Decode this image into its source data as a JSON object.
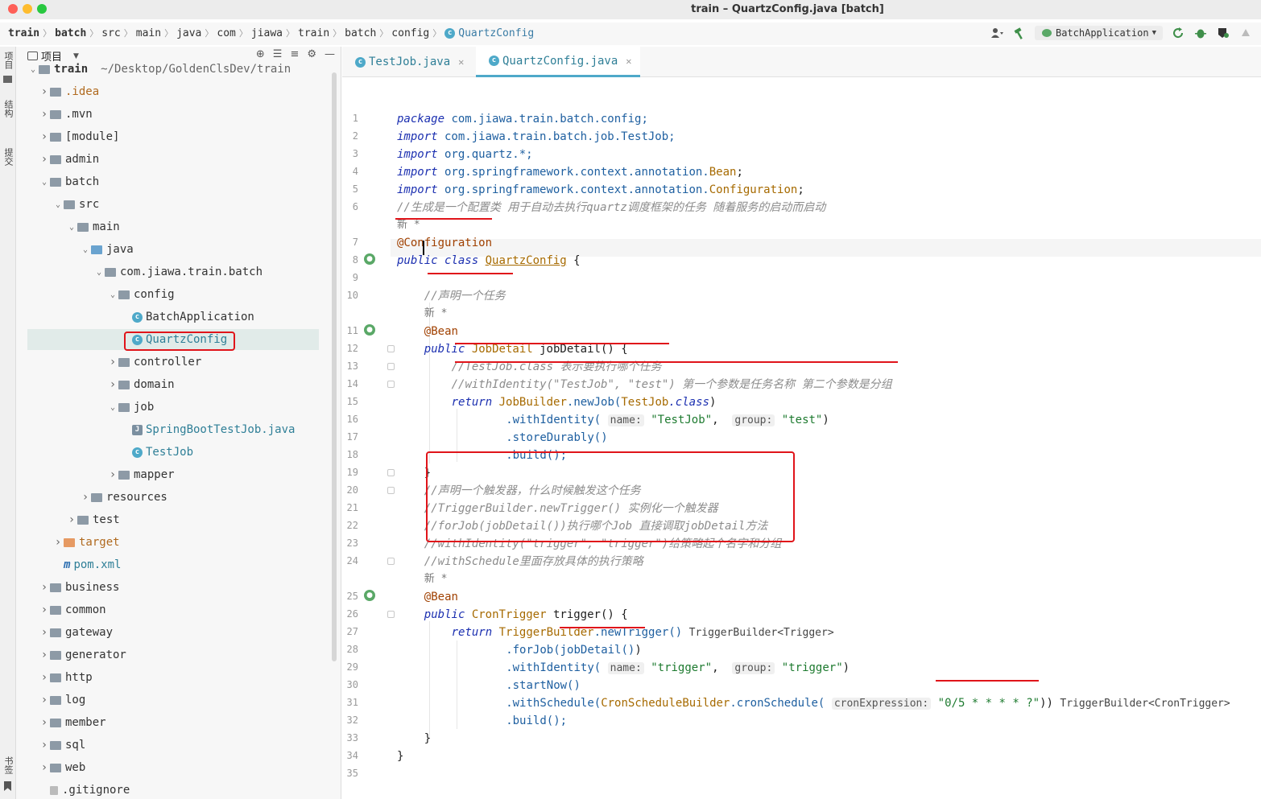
{
  "window": {
    "title": "train – QuartzConfig.java [batch]"
  },
  "breadcrumb": [
    "train",
    "batch",
    "src",
    "main",
    "java",
    "com",
    "jiawa",
    "train",
    "batch",
    "config",
    "QuartzConfig"
  ],
  "toolbar": {
    "run_config": "BatchApplication"
  },
  "left_strip": {
    "tabs": [
      "项目",
      "结构",
      "提交",
      "书签"
    ]
  },
  "project": {
    "title": "项目",
    "root_label": "train",
    "root_path": "~/Desktop/GoldenClsDev/train",
    "items": [
      {
        "label": ".idea",
        "depth": 0,
        "expanded": false,
        "type": "folder",
        "style": "orange"
      },
      {
        "label": ".mvn",
        "depth": 0,
        "expanded": false,
        "type": "folder",
        "style": "gray"
      },
      {
        "label": "[module]",
        "depth": 0,
        "expanded": false,
        "type": "folder",
        "style": "gray"
      },
      {
        "label": "admin",
        "depth": 0,
        "expanded": false,
        "type": "module",
        "style": "default"
      },
      {
        "label": "batch",
        "depth": 0,
        "expanded": true,
        "type": "module",
        "style": "default"
      },
      {
        "label": "src",
        "depth": 1,
        "expanded": true,
        "type": "folder",
        "style": "default"
      },
      {
        "label": "main",
        "depth": 2,
        "expanded": true,
        "type": "folder",
        "style": "default"
      },
      {
        "label": "java",
        "depth": 3,
        "expanded": true,
        "type": "folder-blue",
        "style": "default"
      },
      {
        "label": "com.jiawa.train.batch",
        "depth": 4,
        "expanded": true,
        "type": "package",
        "style": "default"
      },
      {
        "label": "config",
        "depth": 5,
        "expanded": true,
        "type": "package",
        "style": "default"
      },
      {
        "label": "BatchApplication",
        "depth": 6,
        "expanded": null,
        "type": "class",
        "style": "default"
      },
      {
        "label": "QuartzConfig",
        "depth": 6,
        "expanded": null,
        "type": "class",
        "style": "blue"
      },
      {
        "label": "controller",
        "depth": 5,
        "expanded": false,
        "type": "package",
        "style": "default"
      },
      {
        "label": "domain",
        "depth": 5,
        "expanded": false,
        "type": "package",
        "style": "default"
      },
      {
        "label": "job",
        "depth": 5,
        "expanded": true,
        "type": "package",
        "style": "default"
      },
      {
        "label": "SpringBootTestJob.java",
        "depth": 6,
        "expanded": null,
        "type": "javafile",
        "style": "blue"
      },
      {
        "label": "TestJob",
        "depth": 6,
        "expanded": null,
        "type": "class",
        "style": "blue"
      },
      {
        "label": "mapper",
        "depth": 5,
        "expanded": false,
        "type": "package",
        "style": "default"
      },
      {
        "label": "resources",
        "depth": 3,
        "expanded": false,
        "type": "folder",
        "style": "default"
      },
      {
        "label": "test",
        "depth": 2,
        "expanded": false,
        "type": "folder",
        "style": "default"
      },
      {
        "label": "target",
        "depth": 1,
        "expanded": false,
        "type": "folder-orange",
        "style": "orange"
      },
      {
        "label": "pom.xml",
        "depth": 1,
        "expanded": null,
        "type": "maven",
        "style": "blue"
      },
      {
        "label": "business",
        "depth": 0,
        "expanded": false,
        "type": "module",
        "style": "default"
      },
      {
        "label": "common",
        "depth": 0,
        "expanded": false,
        "type": "module",
        "style": "default"
      },
      {
        "label": "gateway",
        "depth": 0,
        "expanded": false,
        "type": "module",
        "style": "default"
      },
      {
        "label": "generator",
        "depth": 0,
        "expanded": false,
        "type": "module",
        "style": "default"
      },
      {
        "label": "http",
        "depth": 0,
        "expanded": false,
        "type": "folder",
        "style": "default"
      },
      {
        "label": "log",
        "depth": 0,
        "expanded": false,
        "type": "folder",
        "style": "default"
      },
      {
        "label": "member",
        "depth": 0,
        "expanded": false,
        "type": "module",
        "style": "default"
      },
      {
        "label": "sql",
        "depth": 0,
        "expanded": false,
        "type": "folder",
        "style": "default"
      },
      {
        "label": "web",
        "depth": 0,
        "expanded": false,
        "type": "folder",
        "style": "default"
      },
      {
        "label": ".gitignore",
        "depth": 0,
        "expanded": null,
        "type": "file",
        "style": "default"
      }
    ]
  },
  "editor": {
    "tabs": [
      {
        "label": "TestJob.java",
        "active": false
      },
      {
        "label": "QuartzConfig.java",
        "active": true
      }
    ],
    "code": {
      "l1_kw": "package",
      "l1_rest": " com.jiawa.train.batch.config;",
      "l2_kw": "import",
      "l2_rest": " com.jiawa.train.batch.job.TestJob;",
      "l3_kw": "import",
      "l3_rest": " org.quartz.*;",
      "l4_kw": "import",
      "l4_pkg": " org.springframework.context.annotation.",
      "l4_cls": "Bean",
      "l4_end": ";",
      "l5_kw": "import",
      "l5_pkg": " org.springframework.context.annotation.",
      "l5_cls": "Configuration",
      "l5_end": ";",
      "l6": "//生成是一个配置类 用于自动去执行quartz调度框架的任务 随着服务的启动而启动",
      "new_marker": "新 *",
      "l7": "@Configuration",
      "l8_kw": "public class",
      "l8_cls": "QuartzConfig",
      "l8_end": " {",
      "l10": "//声明一个任务",
      "l11": "@Bean",
      "l12_kw": "public",
      "l12_type": "JobDetail",
      "l12_rest": " jobDetail() {",
      "l13": "//TestJob.class 表示要执行哪个任务",
      "l14": "//withIdentity(\"TestJob\", \"test\") 第一个参数是任务名称 第二个参数是分组",
      "l15_kw": "return",
      "l15_cls": "JobBuilder",
      "l15_m": ".newJob(",
      "l15_arg": "TestJob",
      "l15_kw2": ".class",
      "l15_end": ")",
      "l16_m": ".withIdentity(",
      "l16_h1": "name:",
      "l16_s1": "\"TestJob\"",
      "l16_h2": "group:",
      "l16_s2": "\"test\"",
      "l16_end": ")",
      "l17": ".storeDurably()",
      "l18": ".build();",
      "l19": "}",
      "l20": "//声明一个触发器，什么时候触发这个任务",
      "l21": "//TriggerBuilder.newTrigger() 实例化一个触发器",
      "l22": "//forJob(jobDetail())执行哪个Job 直接调取jobDetail方法",
      "l23": "//withIdentity(\"trigger\", \"trigger\")给策略起个名字和分组",
      "l24": "//withSchedule里面存放具体的执行策略",
      "l25": "@Bean",
      "l26_kw": "public",
      "l26_type": "CronTrigger",
      "l26_rest": " trigger() {",
      "l27_kw": "return",
      "l27_cls": "TriggerBuilder",
      "l27_m": ".newTrigger()",
      "l27_hint": "TriggerBuilder<Trigger>",
      "l28_m": ".forJob(",
      "l28_arg": "jobDetail()",
      "l28_end": ")",
      "l29_m": ".withIdentity(",
      "l29_h1": "name:",
      "l29_s1": "\"trigger\"",
      "l29_h2": "group:",
      "l29_s2": "\"trigger\"",
      "l29_end": ")",
      "l30": ".startNow()",
      "l31_m": ".withSchedule(",
      "l31_cls": "CronScheduleBuilder",
      "l31_m2": ".cronSchedule(",
      "l31_h": "cronExpression:",
      "l31_s": "\"0/5 * * * * ?\"",
      "l31_end": "))",
      "l31_hint": "TriggerBuilder<CronTrigger>",
      "l32": ".build();",
      "l33": "}",
      "l34": "}"
    },
    "line_numbers": [
      1,
      2,
      3,
      4,
      5,
      6,
      7,
      8,
      9,
      10,
      11,
      12,
      13,
      14,
      15,
      16,
      17,
      18,
      19,
      20,
      21,
      22,
      23,
      24,
      25,
      26,
      27,
      28,
      29,
      30,
      31,
      32,
      33,
      34,
      35
    ]
  },
  "colors": {
    "annotation_red": "#e0141a",
    "accent": "#4ea9c9",
    "keyword": "#1b2fb0",
    "string": "#1d7a2f",
    "comment": "#8c8c8c"
  },
  "icons": [
    "close-icon",
    "minimize-icon",
    "maximize-icon",
    "user-icon",
    "hammer-icon",
    "run-icon",
    "debug-icon",
    "coverage-icon",
    "stop-icon",
    "gear-icon",
    "locate-icon",
    "collapse-icon",
    "expand-icon"
  ]
}
